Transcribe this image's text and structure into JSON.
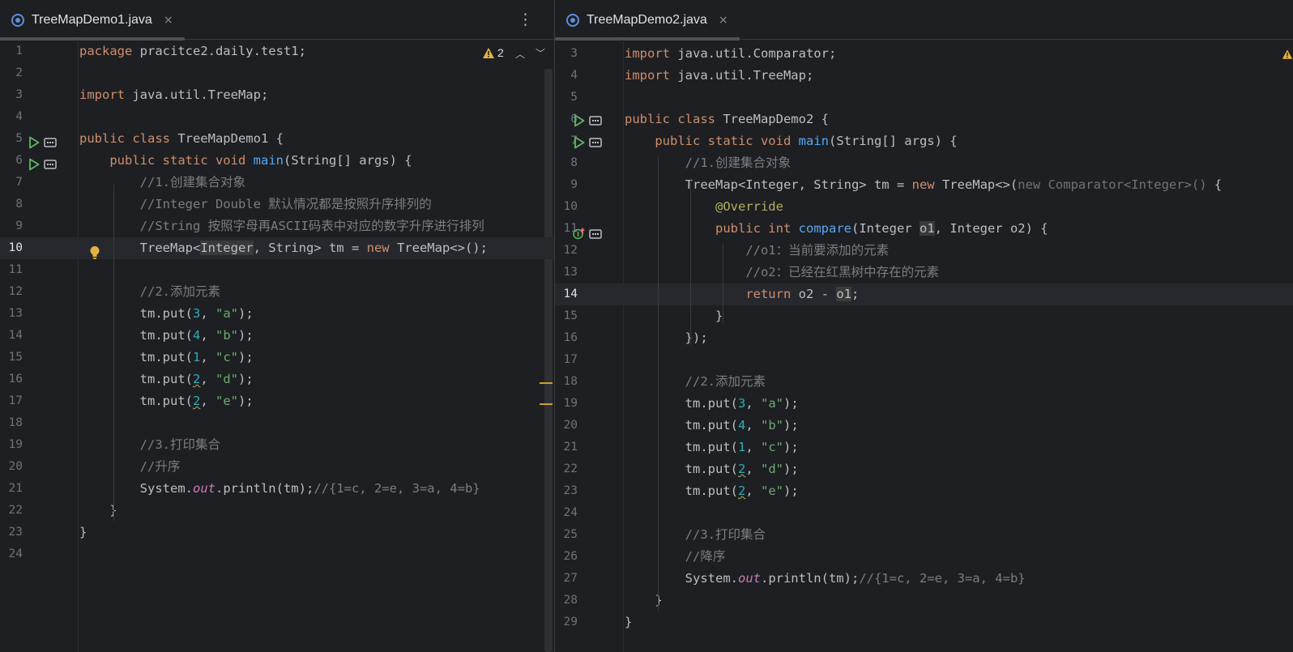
{
  "colors": {
    "accent": "#56a8f5",
    "keyword": "#cf8e6d",
    "string": "#6aab73",
    "number": "#2aacb8",
    "comment": "#7a7e85",
    "annotation": "#b3ae60",
    "warning": "#e3b341"
  },
  "left": {
    "tab": {
      "icon": "java-class-icon",
      "title": "TreeMapDemo1.java",
      "close": "×"
    },
    "more_icon": "⋮",
    "warnings": {
      "icon": "warning-icon",
      "count": "2",
      "up": "^",
      "down": "v"
    },
    "lines": [
      {
        "n": "1",
        "tokens": [
          {
            "t": "package",
            "c": "kw"
          },
          {
            "t": " pracitce2.daily.test1;"
          }
        ]
      },
      {
        "n": "2",
        "tokens": []
      },
      {
        "n": "3",
        "tokens": [
          {
            "t": "import",
            "c": "kw"
          },
          {
            "t": " java.util.TreeMap;"
          }
        ]
      },
      {
        "n": "4",
        "tokens": []
      },
      {
        "n": "5",
        "tokens": [
          {
            "t": "public class",
            "c": "kw"
          },
          {
            "t": " TreeMapDemo1 {"
          }
        ]
      },
      {
        "n": "6",
        "tokens": [
          {
            "t": "    "
          },
          {
            "t": "public static void",
            "c": "kw"
          },
          {
            "t": " "
          },
          {
            "t": "main",
            "c": "fn"
          },
          {
            "t": "(String[] args) {"
          }
        ]
      },
      {
        "n": "7",
        "tokens": [
          {
            "t": "        "
          },
          {
            "t": "//1.创建集合对象",
            "c": "cmt"
          }
        ]
      },
      {
        "n": "8",
        "tokens": [
          {
            "t": "        "
          },
          {
            "t": "//Integer Double 默认情况都是按照升序排列的",
            "c": "cmt"
          }
        ]
      },
      {
        "n": "9",
        "tokens": [
          {
            "t": "        "
          },
          {
            "t": "//String 按照字母再ASCII码表中对应的数字升序进行排列",
            "c": "cmt"
          }
        ]
      },
      {
        "n": "10",
        "tokens": [
          {
            "t": "        TreeMap<"
          },
          {
            "t": "Integer",
            "c": "hl"
          },
          {
            "t": ", String> tm = "
          },
          {
            "t": "new",
            "c": "kw"
          },
          {
            "t": " TreeMap<>();"
          }
        ]
      },
      {
        "n": "11",
        "tokens": []
      },
      {
        "n": "12",
        "tokens": [
          {
            "t": "        "
          },
          {
            "t": "//2.添加元素",
            "c": "cmt"
          }
        ]
      },
      {
        "n": "13",
        "tokens": [
          {
            "t": "        tm.put("
          },
          {
            "t": "3",
            "c": "num"
          },
          {
            "t": ", "
          },
          {
            "t": "\"a\"",
            "c": "str"
          },
          {
            "t": ");"
          }
        ]
      },
      {
        "n": "14",
        "tokens": [
          {
            "t": "        tm.put("
          },
          {
            "t": "4",
            "c": "num"
          },
          {
            "t": ", "
          },
          {
            "t": "\"b\"",
            "c": "str"
          },
          {
            "t": ");"
          }
        ]
      },
      {
        "n": "15",
        "tokens": [
          {
            "t": "        tm.put("
          },
          {
            "t": "1",
            "c": "num"
          },
          {
            "t": ", "
          },
          {
            "t": "\"c\"",
            "c": "str"
          },
          {
            "t": ");"
          }
        ]
      },
      {
        "n": "16",
        "tokens": [
          {
            "t": "        tm.put("
          },
          {
            "t": "2",
            "c": "num squig"
          },
          {
            "t": ", "
          },
          {
            "t": "\"d\"",
            "c": "str"
          },
          {
            "t": ");"
          }
        ]
      },
      {
        "n": "17",
        "tokens": [
          {
            "t": "        tm.put("
          },
          {
            "t": "2",
            "c": "num squig"
          },
          {
            "t": ", "
          },
          {
            "t": "\"e\"",
            "c": "str"
          },
          {
            "t": ");"
          }
        ]
      },
      {
        "n": "18",
        "tokens": []
      },
      {
        "n": "19",
        "tokens": [
          {
            "t": "        "
          },
          {
            "t": "//3.打印集合",
            "c": "cmt"
          }
        ]
      },
      {
        "n": "20",
        "tokens": [
          {
            "t": "        "
          },
          {
            "t": "//升序",
            "c": "cmt"
          }
        ]
      },
      {
        "n": "21",
        "tokens": [
          {
            "t": "        System."
          },
          {
            "t": "out",
            "c": "sfield"
          },
          {
            "t": ".println(tm);"
          },
          {
            "t": "//{1=c, 2=e, 3=a, 4=b}",
            "c": "cmt"
          }
        ]
      },
      {
        "n": "22",
        "tokens": [
          {
            "t": "    }"
          }
        ]
      },
      {
        "n": "23",
        "tokens": [
          {
            "t": "}"
          }
        ]
      },
      {
        "n": "24",
        "tokens": []
      }
    ]
  },
  "right": {
    "tab": {
      "icon": "java-class-icon",
      "title": "TreeMapDemo2.java",
      "close": "×"
    },
    "lines": [
      {
        "n": "3",
        "tokens": [
          {
            "t": "import",
            "c": "kw"
          },
          {
            "t": " java.util.Comparator;"
          }
        ]
      },
      {
        "n": "4",
        "tokens": [
          {
            "t": "import",
            "c": "kw"
          },
          {
            "t": " java.util.TreeMap;"
          }
        ]
      },
      {
        "n": "5",
        "tokens": []
      },
      {
        "n": "6",
        "tokens": [
          {
            "t": "public class",
            "c": "kw"
          },
          {
            "t": " TreeMapDemo2 {"
          }
        ]
      },
      {
        "n": "7",
        "tokens": [
          {
            "t": "    "
          },
          {
            "t": "public static void",
            "c": "kw"
          },
          {
            "t": " "
          },
          {
            "t": "main",
            "c": "fn"
          },
          {
            "t": "(String[] args) {"
          }
        ]
      },
      {
        "n": "8",
        "tokens": [
          {
            "t": "        "
          },
          {
            "t": "//1.创建集合对象",
            "c": "cmt"
          }
        ]
      },
      {
        "n": "9",
        "tokens": [
          {
            "t": "        TreeMap<Integer, String> tm = "
          },
          {
            "t": "new",
            "c": "kw"
          },
          {
            "t": " TreeMap<>("
          },
          {
            "t": "new Comparator<Integer>()",
            "c": "dim"
          },
          {
            "t": " {"
          }
        ]
      },
      {
        "n": "10",
        "tokens": [
          {
            "t": "            "
          },
          {
            "t": "@Override",
            "c": "ann"
          }
        ]
      },
      {
        "n": "11",
        "tokens": [
          {
            "t": "            "
          },
          {
            "t": "public int",
            "c": "kw"
          },
          {
            "t": " "
          },
          {
            "t": "compare",
            "c": "fn"
          },
          {
            "t": "(Integer "
          },
          {
            "t": "o1",
            "c": "hl"
          },
          {
            "t": ", Integer o2) {"
          }
        ]
      },
      {
        "n": "12",
        "tokens": [
          {
            "t": "                "
          },
          {
            "t": "//o1：当前要添加的元素",
            "c": "cmt"
          }
        ]
      },
      {
        "n": "13",
        "tokens": [
          {
            "t": "                "
          },
          {
            "t": "//o2：已经在红黑树中存在的元素",
            "c": "cmt"
          }
        ]
      },
      {
        "n": "14",
        "tokens": [
          {
            "t": "                "
          },
          {
            "t": "return",
            "c": "kw"
          },
          {
            "t": " o2 - "
          },
          {
            "t": "o1",
            "c": "hl"
          },
          {
            "t": ";"
          }
        ]
      },
      {
        "n": "15",
        "tokens": [
          {
            "t": "            }"
          }
        ]
      },
      {
        "n": "16",
        "tokens": [
          {
            "t": "        });"
          }
        ]
      },
      {
        "n": "17",
        "tokens": []
      },
      {
        "n": "18",
        "tokens": [
          {
            "t": "        "
          },
          {
            "t": "//2.添加元素",
            "c": "cmt"
          }
        ]
      },
      {
        "n": "19",
        "tokens": [
          {
            "t": "        tm.put("
          },
          {
            "t": "3",
            "c": "num"
          },
          {
            "t": ", "
          },
          {
            "t": "\"a\"",
            "c": "str"
          },
          {
            "t": ");"
          }
        ]
      },
      {
        "n": "20",
        "tokens": [
          {
            "t": "        tm.put("
          },
          {
            "t": "4",
            "c": "num"
          },
          {
            "t": ", "
          },
          {
            "t": "\"b\"",
            "c": "str"
          },
          {
            "t": ");"
          }
        ]
      },
      {
        "n": "21",
        "tokens": [
          {
            "t": "        tm.put("
          },
          {
            "t": "1",
            "c": "num"
          },
          {
            "t": ", "
          },
          {
            "t": "\"c\"",
            "c": "str"
          },
          {
            "t": ");"
          }
        ]
      },
      {
        "n": "22",
        "tokens": [
          {
            "t": "        tm.put("
          },
          {
            "t": "2",
            "c": "num squig"
          },
          {
            "t": ", "
          },
          {
            "t": "\"d\"",
            "c": "str"
          },
          {
            "t": ");"
          }
        ]
      },
      {
        "n": "23",
        "tokens": [
          {
            "t": "        tm.put("
          },
          {
            "t": "2",
            "c": "num squig"
          },
          {
            "t": ", "
          },
          {
            "t": "\"e\"",
            "c": "str"
          },
          {
            "t": ");"
          }
        ]
      },
      {
        "n": "24",
        "tokens": []
      },
      {
        "n": "25",
        "tokens": [
          {
            "t": "        "
          },
          {
            "t": "//3.打印集合",
            "c": "cmt"
          }
        ]
      },
      {
        "n": "26",
        "tokens": [
          {
            "t": "        "
          },
          {
            "t": "//降序",
            "c": "cmt"
          }
        ]
      },
      {
        "n": "27",
        "tokens": [
          {
            "t": "        System."
          },
          {
            "t": "out",
            "c": "sfield"
          },
          {
            "t": ".println(tm);"
          },
          {
            "t": "//{1=c, 2=e, 3=a, 4=b}",
            "c": "cmt"
          }
        ]
      },
      {
        "n": "28",
        "tokens": [
          {
            "t": "    }"
          }
        ]
      },
      {
        "n": "29",
        "tokens": [
          {
            "t": "}"
          }
        ]
      }
    ]
  }
}
